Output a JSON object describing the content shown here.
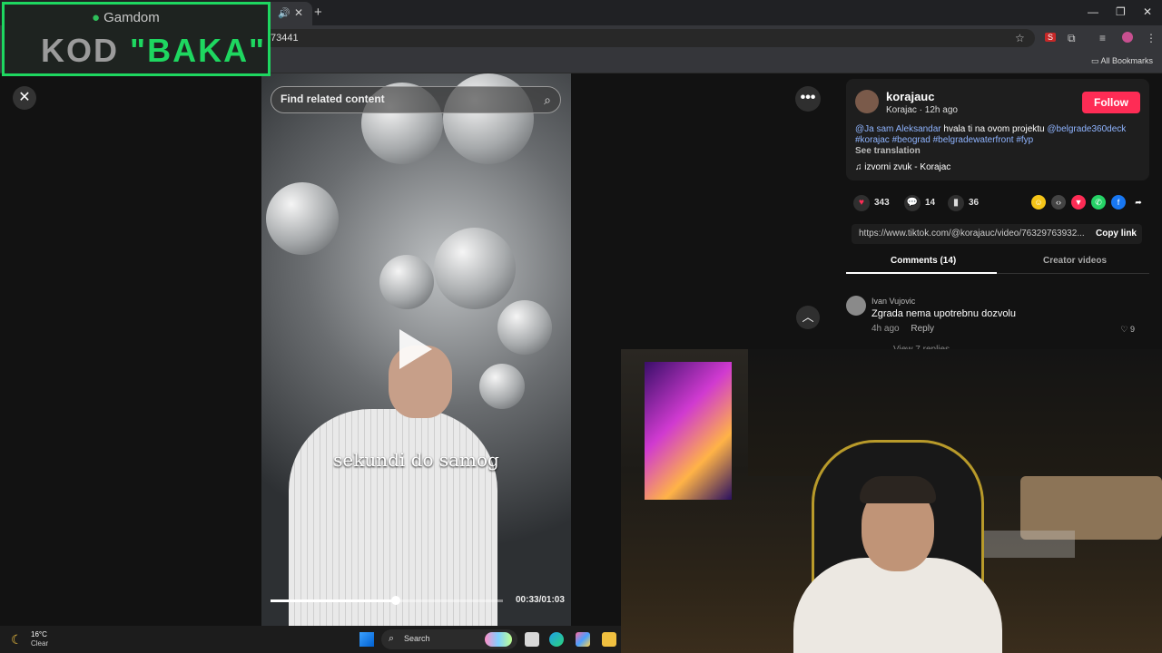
{
  "browser": {
    "url_partial": "73441",
    "all_bookmarks": "All Bookmarks",
    "extension_badge": "S"
  },
  "promo": {
    "brand": "Gamdom",
    "code_prefix": "KOD ",
    "code_value": "\"BAKA\""
  },
  "video": {
    "search_placeholder": "Find related content",
    "caption": "sekundi do samog",
    "time": "00:33/01:03",
    "progress": 0.54
  },
  "author": {
    "username": "korajauc",
    "display_line": "Korajac · 12h ago",
    "follow_label": "Follow"
  },
  "description": {
    "mention1": "@Ja sam Aleksandar",
    "text": " hvala ti na ovom projektu ",
    "mention2": "@belgrade360deck",
    "hashtags": "#korajac #beograd #belgradewaterfront #fyp",
    "see_translation": "See translation",
    "music": "izvorni zvuk - Korajac"
  },
  "stats": {
    "likes": "343",
    "comments": "14",
    "saves": "36"
  },
  "share": {
    "link": "https://www.tiktok.com/@korajauc/video/76329763932...",
    "copy_label": "Copy link"
  },
  "tabs": {
    "comments": "Comments (14)",
    "creator_videos": "Creator videos"
  },
  "comment": {
    "author": "Ivan Vujovic",
    "text": "Zgrada nema upotrebnu dozvolu",
    "time": "4h ago",
    "reply": "Reply",
    "likes": "9",
    "view_replies": "View 7 replies"
  },
  "taskbar": {
    "temp": "16°C",
    "condition": "Clear",
    "search": "Search"
  },
  "colors": {
    "follow": "#fe2c55",
    "promo_border": "#1ed760",
    "link_tag": "#8fb4ff"
  }
}
